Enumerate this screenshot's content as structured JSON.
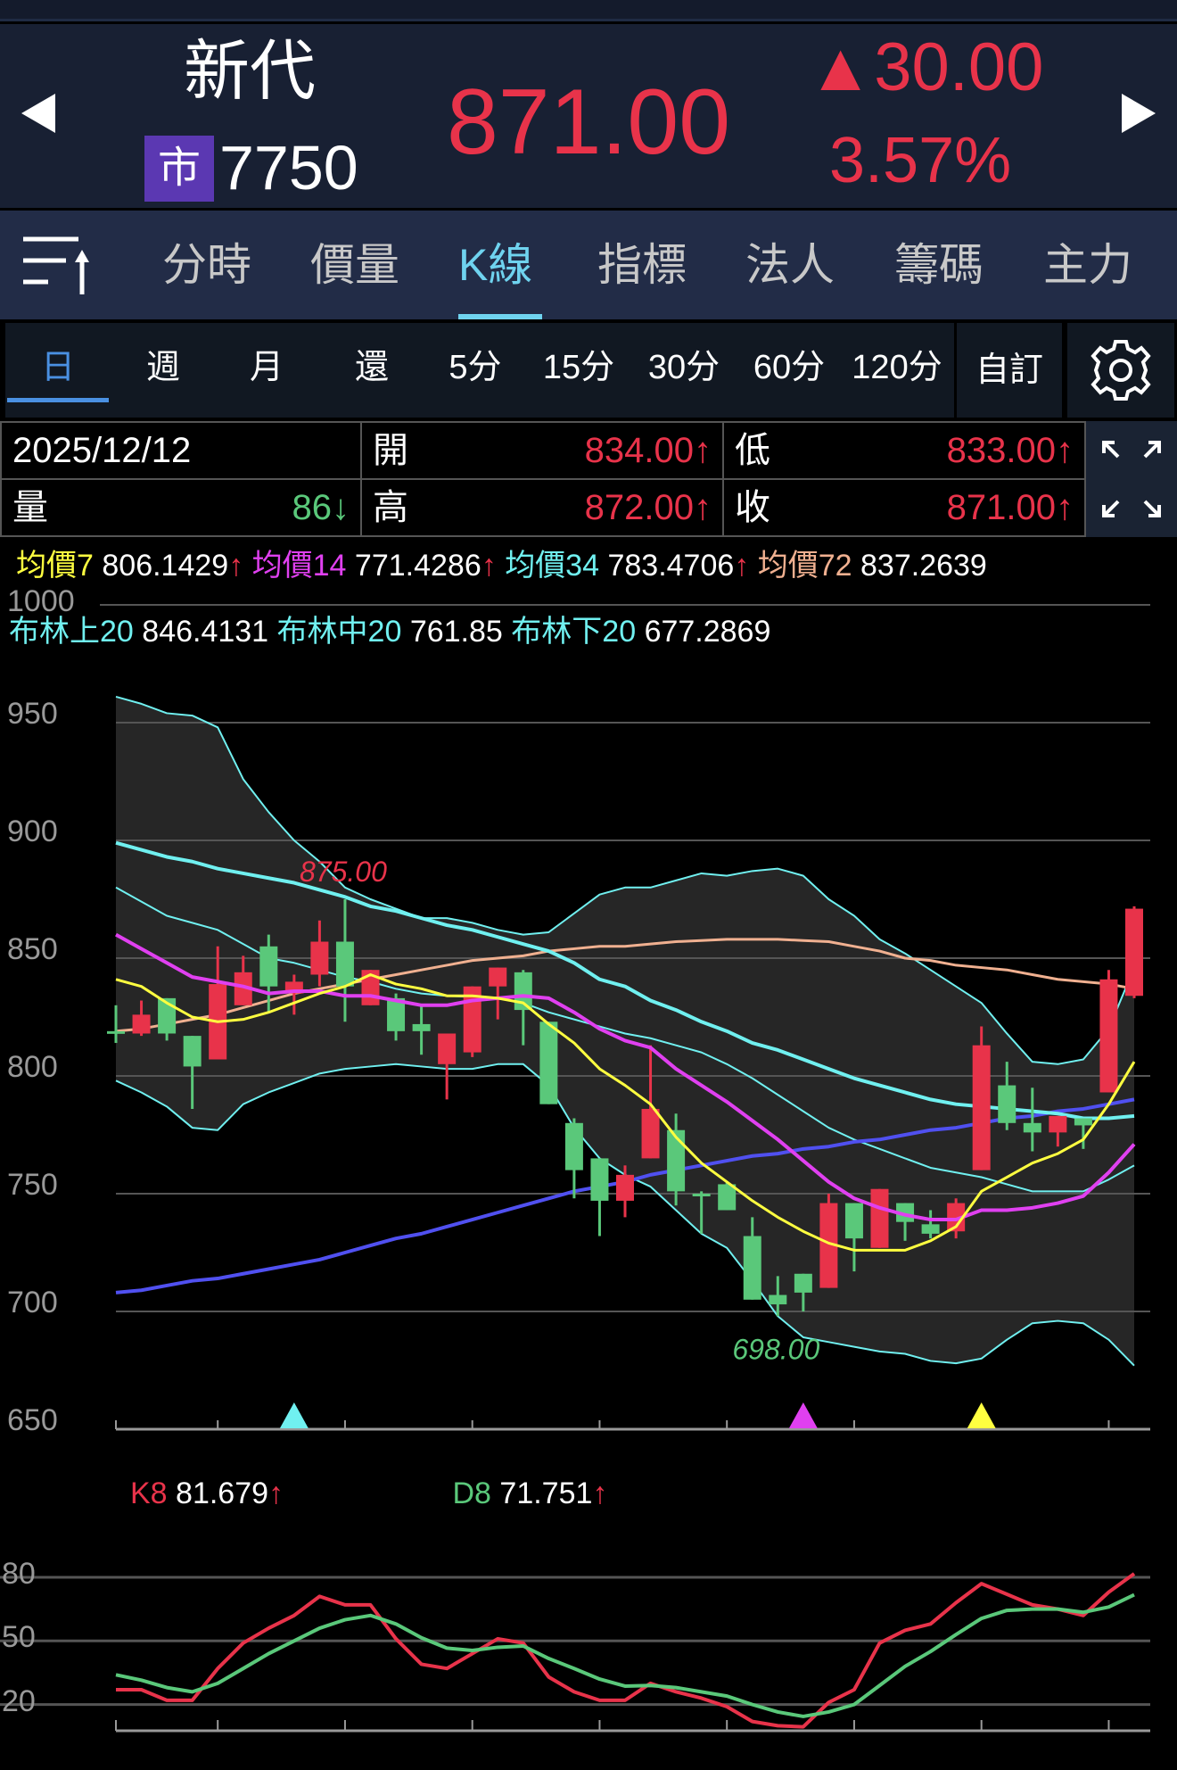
{
  "header": {
    "name": "新代",
    "market_badge": "市",
    "code": "7750",
    "price": "871.00",
    "change": "▲30.00",
    "change_pct": "3.57%",
    "prev_icon": "triangle-left-icon",
    "next_icon": "triangle-right-icon"
  },
  "tabs": [
    {
      "label": "分時"
    },
    {
      "label": "價量"
    },
    {
      "label": "K線",
      "active": true
    },
    {
      "label": "指標"
    },
    {
      "label": "法人"
    },
    {
      "label": "籌碼"
    },
    {
      "label": "主力"
    }
  ],
  "periods": [
    {
      "label": "日",
      "active": true
    },
    {
      "label": "週"
    },
    {
      "label": "月"
    },
    {
      "label": "還"
    },
    {
      "label": "5分"
    },
    {
      "label": "15分"
    },
    {
      "label": "30分"
    },
    {
      "label": "60分"
    },
    {
      "label": "120分"
    }
  ],
  "custom_label": "自訂",
  "info": {
    "date": "2025/12/12",
    "open_label": "開",
    "open": "834.00↑",
    "low_label": "低",
    "low": "833.00↑",
    "vol_label": "量",
    "vol": "86↓",
    "high_label": "高",
    "high": "872.00↑",
    "close_label": "收",
    "close": "871.00↑"
  },
  "ma_legend": [
    {
      "label": "均價7",
      "value": "806.1429",
      "arrow": "↑",
      "color": "#ffff40"
    },
    {
      "label": "均價14",
      "value": "771.4286",
      "arrow": "↑",
      "color": "#e040f0"
    },
    {
      "label": "均價34",
      "value": "783.4706",
      "arrow": "↑",
      "color": "#70f0f0"
    },
    {
      "label": "均價72",
      "value": "837.2639",
      "arrow": "",
      "color": "#f0b090"
    }
  ],
  "bb_legend": [
    {
      "label": "布林上20",
      "value": "846.4131"
    },
    {
      "label": "布林中20",
      "value": "761.85"
    },
    {
      "label": "布林下20",
      "value": "677.2869"
    }
  ],
  "kd_legend": [
    {
      "label": "K8",
      "value": "81.679",
      "arrow": "↑"
    },
    {
      "label": "D8",
      "value": "71.751",
      "arrow": "↑"
    }
  ],
  "colors": {
    "up": "#e8334a",
    "down": "#5ac87a",
    "accent": "#6fd3ef",
    "ma7": "#ffff40",
    "ma14": "#e040f0",
    "ma34": "#70f0f0",
    "ma72": "#f0b090",
    "long_ma": "#5050f0",
    "bollinger": "#70f0f0"
  },
  "chart_data": [
    {
      "type": "candlestick",
      "yticks": [
        1000,
        950,
        900,
        850,
        800,
        750,
        700,
        650
      ],
      "ylim": [
        650,
        1000
      ],
      "open": [
        819,
        818,
        833,
        817,
        807,
        830,
        855,
        835,
        843,
        857,
        830,
        833,
        822,
        805,
        810,
        838,
        844,
        823,
        780,
        765,
        747,
        765,
        777,
        750,
        754,
        732,
        707,
        716,
        710,
        746,
        727,
        746,
        737,
        734,
        760,
        796,
        780,
        776,
        782,
        793,
        834
      ],
      "high": [
        830,
        832,
        833,
        817,
        855,
        851,
        860,
        843,
        866,
        875,
        845,
        835,
        830,
        818,
        838,
        846,
        845,
        823,
        782,
        765,
        762,
        813,
        784,
        751,
        755,
        740,
        715,
        716,
        750,
        746,
        752,
        746,
        743,
        748,
        821,
        806,
        795,
        783,
        782,
        845,
        872
      ],
      "low": [
        814,
        817,
        815,
        786,
        807,
        830,
        827,
        826,
        838,
        823,
        830,
        815,
        809,
        790,
        808,
        824,
        813,
        788,
        748,
        732,
        740,
        765,
        745,
        733,
        743,
        705,
        698,
        700,
        710,
        717,
        727,
        730,
        731,
        731,
        760,
        777,
        768,
        770,
        769,
        793,
        833
      ],
      "close": [
        819,
        826,
        818,
        804,
        839,
        844,
        838,
        840,
        857,
        838,
        845,
        819,
        819,
        818,
        838,
        846,
        828,
        788,
        760,
        747,
        758,
        786,
        751,
        749,
        743,
        705,
        703,
        708,
        746,
        731,
        752,
        738,
        733,
        746,
        813,
        780,
        776,
        783,
        779,
        841,
        871
      ],
      "annotations": [
        {
          "text": "875.00",
          "index": 9,
          "kind": "high"
        },
        {
          "text": "698.00",
          "index": 26,
          "kind": "low"
        }
      ],
      "signals": [
        {
          "index": 7,
          "color": "#70f0f0"
        },
        {
          "index": 27,
          "color": "#e040f0"
        },
        {
          "index": 34,
          "color": "#ffff40"
        }
      ],
      "lines": {
        "ma7": [
          841,
          838,
          831,
          825,
          823,
          824,
          827,
          831,
          835,
          838,
          843,
          839,
          837,
          834,
          834,
          833,
          831,
          822,
          814,
          803,
          796,
          788,
          774,
          763,
          755,
          747,
          740,
          734,
          729,
          726,
          726,
          726,
          730,
          736,
          751,
          757,
          763,
          767,
          773,
          788,
          806
        ],
        "ma14": [
          860,
          854,
          848,
          842,
          840,
          838,
          835,
          836,
          836,
          834,
          834,
          832,
          830,
          830,
          832,
          833,
          834,
          833,
          827,
          820,
          815,
          812,
          803,
          796,
          789,
          781,
          773,
          764,
          755,
          748,
          744,
          741,
          739,
          739,
          743,
          743,
          744,
          746,
          749,
          759,
          771
        ],
        "ma34": [
          899,
          896,
          893,
          891,
          888,
          886,
          884,
          882,
          879,
          876,
          872,
          870,
          867,
          864,
          862,
          859,
          856,
          853,
          848,
          841,
          838,
          832,
          828,
          823,
          819,
          814,
          811,
          807,
          803,
          799,
          796,
          793,
          790,
          788,
          787,
          786,
          785,
          784,
          782,
          782,
          783
        ],
        "ma72": [
          819,
          820,
          822,
          824,
          826,
          829,
          832,
          835,
          837,
          839,
          841,
          843,
          845,
          847,
          849,
          850,
          851,
          853,
          854,
          855,
          855,
          856,
          857,
          857.5,
          858,
          858,
          858,
          857.5,
          857,
          855,
          853,
          850,
          849,
          847,
          846,
          845,
          843,
          841,
          840,
          839,
          837
        ],
        "long_ma": [
          708,
          709,
          711,
          713,
          714,
          716,
          718,
          720,
          722,
          725,
          728,
          731,
          733,
          736,
          739,
          742,
          745,
          748,
          751,
          753,
          755,
          758,
          760,
          762,
          764,
          766,
          767,
          769,
          770,
          772,
          773,
          775,
          777,
          778,
          780,
          782,
          783,
          785,
          786,
          788,
          790
        ],
        "bb_upper": [
          961,
          958,
          954,
          953,
          948,
          926,
          912,
          900,
          891,
          880,
          875,
          871,
          867,
          867,
          865,
          862,
          860,
          861,
          869,
          877,
          880,
          880,
          883,
          886,
          885,
          887,
          888,
          885,
          875,
          868,
          858,
          852,
          845,
          838,
          831,
          818,
          806,
          805,
          807,
          820,
          846
        ],
        "bb_mid": [
          880,
          874,
          868,
          865,
          862,
          856,
          850,
          848,
          845,
          842,
          840,
          837,
          835,
          834,
          833.5,
          833,
          831,
          827,
          824,
          821,
          818,
          816,
          813,
          810,
          805,
          799,
          792,
          785,
          778,
          773,
          769,
          765,
          761,
          759,
          757,
          754,
          751,
          751,
          751,
          756,
          762
        ],
        "bb_lower": [
          798,
          793,
          787,
          778,
          777,
          788,
          793,
          797,
          801,
          803,
          804,
          805,
          804,
          803,
          803,
          805,
          805,
          796,
          778,
          765,
          758,
          753,
          743,
          733,
          727,
          713,
          698,
          689,
          687,
          685,
          683,
          682,
          679,
          678,
          680,
          688,
          695,
          696,
          695,
          688,
          677
        ]
      }
    },
    {
      "type": "line",
      "yticks": [
        80,
        50,
        20
      ],
      "ylim": [
        0,
        100
      ],
      "series": [
        {
          "name": "K8",
          "color": "#e8334a",
          "values": [
            27,
            27,
            22,
            22,
            37,
            49,
            56,
            62,
            71,
            67,
            67,
            51,
            39,
            37,
            44,
            51,
            49,
            33,
            26,
            22,
            22,
            30,
            26,
            23,
            19,
            12,
            10,
            9.5,
            21,
            27,
            49,
            55,
            58,
            68,
            77,
            72,
            67,
            65,
            62,
            73,
            81.7
          ]
        },
        {
          "name": "D8",
          "color": "#5ac87a",
          "values": [
            34,
            31.5,
            28,
            26,
            30,
            37,
            44,
            50,
            56,
            60,
            62,
            58,
            51.5,
            46.6,
            45.5,
            47,
            47.6,
            41.7,
            37,
            32,
            28.7,
            29,
            28,
            26,
            24,
            20,
            16.5,
            14.4,
            16.5,
            20,
            29,
            38,
            45,
            53,
            60.6,
            64.4,
            65,
            65,
            63.5,
            66,
            71.75
          ]
        }
      ]
    }
  ]
}
